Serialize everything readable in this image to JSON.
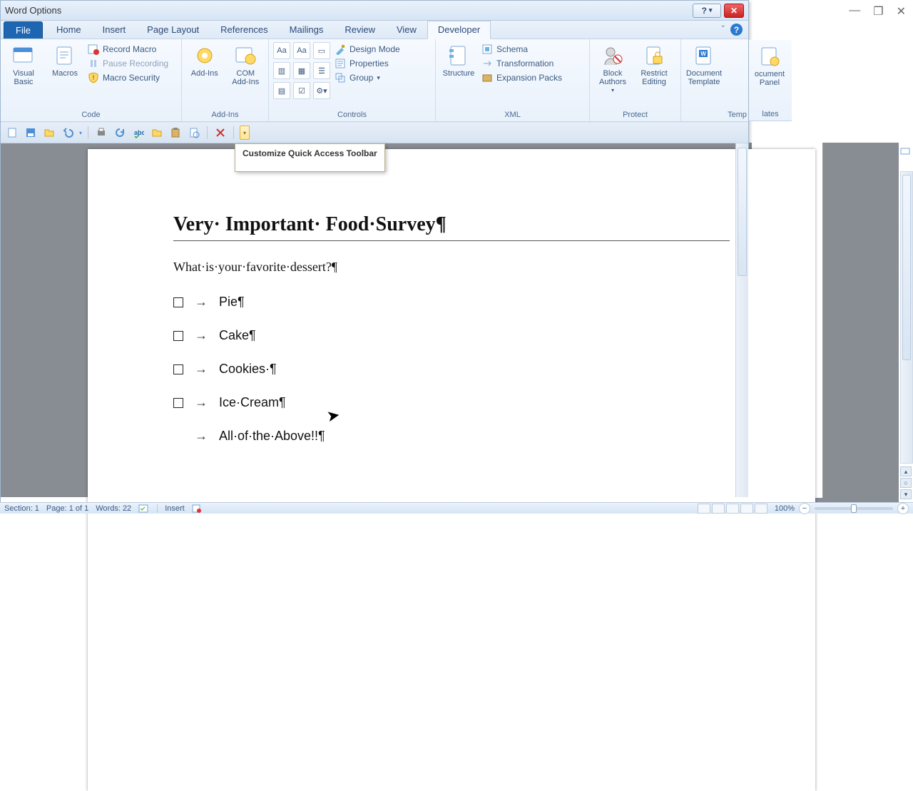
{
  "window": {
    "title": "Word Options"
  },
  "tabs": {
    "file": "File",
    "items": [
      "Home",
      "Insert",
      "Page Layout",
      "References",
      "Mailings",
      "Review",
      "View",
      "Developer"
    ],
    "active": "Developer"
  },
  "ribbon": {
    "code": {
      "label": "Code",
      "visual_basic": "Visual\nBasic",
      "macros": "Macros",
      "record_macro": "Record Macro",
      "pause_recording": "Pause Recording",
      "macro_security": "Macro Security"
    },
    "addins": {
      "label": "Add-Ins",
      "addins": "Add-Ins",
      "com_addins": "COM\nAdd-Ins"
    },
    "controls": {
      "label": "Controls",
      "design_mode": "Design Mode",
      "properties": "Properties",
      "group": "Group"
    },
    "xml": {
      "label": "XML",
      "structure": "Structure",
      "schema": "Schema",
      "transformation": "Transformation",
      "expansion_packs": "Expansion Packs"
    },
    "protect": {
      "label": "Protect",
      "block_authors": "Block\nAuthors",
      "restrict_editing": "Restrict\nEditing"
    },
    "templates": {
      "label": "Templates",
      "document_template": "Document\nTemplate",
      "document_panel": "ocument\nPanel",
      "right_label": "Temp"
    }
  },
  "tooltip": "Customize Quick Access Toolbar",
  "document": {
    "title": "Very· Important· Food·Survey¶",
    "question": "What·is·your·favorite·dessert?¶",
    "options": [
      {
        "checkbox": true,
        "text": "Pie¶"
      },
      {
        "checkbox": true,
        "text": "Cake¶"
      },
      {
        "checkbox": true,
        "text": "Cookies·¶"
      },
      {
        "checkbox": true,
        "text": "Ice·Cream¶"
      },
      {
        "checkbox": false,
        "text": "All·of·the·Above!!¶"
      }
    ]
  },
  "status": {
    "section": "Section: 1",
    "page": "Page: 1 of 1",
    "words": "Words: 22",
    "insert": "Insert",
    "zoom": "100%"
  }
}
